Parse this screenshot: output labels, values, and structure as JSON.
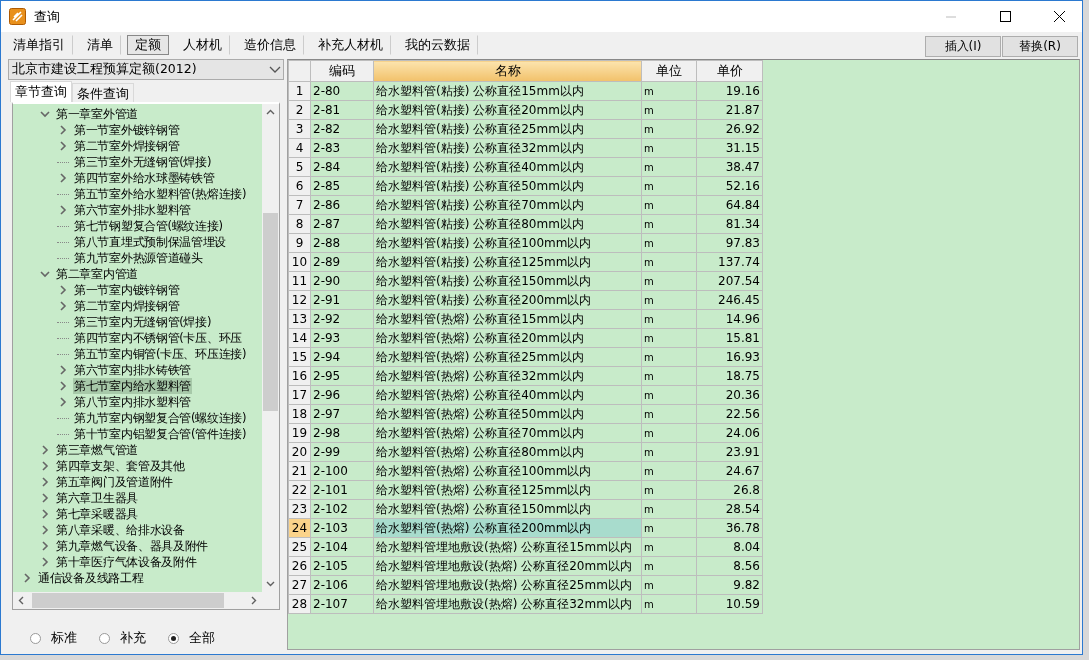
{
  "window": {
    "title": "查询"
  },
  "tabs": [
    {
      "label": "清单指引",
      "selected": false
    },
    {
      "label": "清单",
      "selected": false
    },
    {
      "label": "定额",
      "selected": true
    },
    {
      "label": "人材机",
      "selected": false
    },
    {
      "label": "造价信息",
      "selected": false
    },
    {
      "label": "补充人材机",
      "selected": false
    },
    {
      "label": "我的云数据",
      "selected": false
    }
  ],
  "buttons": [
    "插入(I)",
    "替换(R)"
  ],
  "quota_dropdown": {
    "value": "北京市建设工程预算定额(2012)"
  },
  "sub_tabs": [
    {
      "label": "章节查询",
      "selected": true
    },
    {
      "label": "条件查询",
      "selected": false
    }
  ],
  "tree": {
    "items": [
      {
        "kind": "group",
        "children": [
          {
            "label": "第一章室外管道",
            "kind": "folder",
            "expanded": true,
            "selected": false,
            "children": [
              {
                "label": "第一节室外镀锌钢管",
                "kind": "folder",
                "expanded": false,
                "selected": false
              },
              {
                "label": "第二节室外焊接钢管",
                "kind": "folder",
                "expanded": false,
                "selected": false
              },
              {
                "label": "第三节室外无缝钢管(焊接)",
                "kind": "leaf",
                "selected": false
              },
              {
                "label": "第四节室外给水球墨铸铁管",
                "kind": "folder",
                "expanded": false,
                "selected": false
              },
              {
                "label": "第五节室外给水塑料管(热熔连接)",
                "kind": "leaf",
                "selected": false
              },
              {
                "label": "第六节室外排水塑料管",
                "kind": "folder",
                "expanded": false,
                "selected": false
              },
              {
                "label": "第七节钢塑复合管(螺纹连接)",
                "kind": "leaf",
                "selected": false
              },
              {
                "label": "第八节直埋式预制保温管埋设",
                "kind": "leaf",
                "selected": false
              },
              {
                "label": "第九节室外热源管道碰头",
                "kind": "leaf",
                "selected": false
              }
            ]
          },
          {
            "label": "第二章室内管道",
            "kind": "folder",
            "expanded": true,
            "selected": false,
            "children": [
              {
                "label": "第一节室内镀锌钢管",
                "kind": "folder",
                "expanded": false,
                "selected": false
              },
              {
                "label": "第二节室内焊接钢管",
                "kind": "folder",
                "expanded": false,
                "selected": false
              },
              {
                "label": "第三节室内无缝钢管(焊接)",
                "kind": "leaf",
                "selected": false
              },
              {
                "label": "第四节室内不锈钢管(卡压、环压",
                "kind": "leaf",
                "selected": false
              },
              {
                "label": "第五节室内铜管(卡压、环压连接)",
                "kind": "leaf",
                "selected": false
              },
              {
                "label": "第六节室内排水铸铁管",
                "kind": "folder",
                "expanded": false,
                "selected": false
              },
              {
                "label": "第七节室内给水塑料管",
                "kind": "folder",
                "expanded": false,
                "selected": true
              },
              {
                "label": "第八节室内排水塑料管",
                "kind": "folder",
                "expanded": false,
                "selected": false
              },
              {
                "label": "第九节室内钢塑复合管(螺纹连接)",
                "kind": "leaf",
                "selected": false
              },
              {
                "label": "第十节室内铝塑复合管(管件连接)",
                "kind": "leaf",
                "selected": false
              }
            ]
          },
          {
            "label": "第三章燃气管道",
            "kind": "folder",
            "expanded": false,
            "selected": false
          },
          {
            "label": "第四章支架、套管及其他",
            "kind": "folder",
            "expanded": false,
            "selected": false
          },
          {
            "label": "第五章阀门及管道附件",
            "kind": "folder",
            "expanded": false,
            "selected": false
          },
          {
            "label": "第六章卫生器具",
            "kind": "folder",
            "expanded": false,
            "selected": false
          },
          {
            "label": "第七章采暖器具",
            "kind": "folder",
            "expanded": false,
            "selected": false
          },
          {
            "label": "第八章采暖、给排水设备",
            "kind": "folder",
            "expanded": false,
            "selected": false
          },
          {
            "label": "第九章燃气设备、器具及附件",
            "kind": "folder",
            "expanded": false,
            "selected": false
          },
          {
            "label": "第十章医疗气体设备及附件",
            "kind": "folder",
            "expanded": false,
            "selected": false
          }
        ]
      },
      {
        "label": "通信设备及线路工程",
        "kind": "folder",
        "expanded": false,
        "selected": false
      }
    ]
  },
  "filter_radios": [
    {
      "label": "标准",
      "selected": false
    },
    {
      "label": "补充",
      "selected": false
    },
    {
      "label": "全部",
      "selected": true
    }
  ],
  "table": {
    "columns": [
      {
        "label": "编码",
        "highlighted": false
      },
      {
        "label": "名称",
        "highlighted": true
      },
      {
        "label": "单位",
        "highlighted": false
      },
      {
        "label": "单价",
        "highlighted": false
      }
    ],
    "rows": [
      {
        "no": "1",
        "code": "2-80",
        "name": "给水塑料管(粘接) 公称直径15mm以内",
        "unit": "m",
        "price": "19.16",
        "selected": false
      },
      {
        "no": "2",
        "code": "2-81",
        "name": "给水塑料管(粘接) 公称直径20mm以内",
        "unit": "m",
        "price": "21.87",
        "selected": false
      },
      {
        "no": "3",
        "code": "2-82",
        "name": "给水塑料管(粘接) 公称直径25mm以内",
        "unit": "m",
        "price": "26.92",
        "selected": false
      },
      {
        "no": "4",
        "code": "2-83",
        "name": "给水塑料管(粘接) 公称直径32mm以内",
        "unit": "m",
        "price": "31.15",
        "selected": false
      },
      {
        "no": "5",
        "code": "2-84",
        "name": "给水塑料管(粘接) 公称直径40mm以内",
        "unit": "m",
        "price": "38.47",
        "selected": false
      },
      {
        "no": "6",
        "code": "2-85",
        "name": "给水塑料管(粘接) 公称直径50mm以内",
        "unit": "m",
        "price": "52.16",
        "selected": false
      },
      {
        "no": "7",
        "code": "2-86",
        "name": "给水塑料管(粘接) 公称直径70mm以内",
        "unit": "m",
        "price": "64.84",
        "selected": false
      },
      {
        "no": "8",
        "code": "2-87",
        "name": "给水塑料管(粘接) 公称直径80mm以内",
        "unit": "m",
        "price": "81.34",
        "selected": false
      },
      {
        "no": "9",
        "code": "2-88",
        "name": "给水塑料管(粘接) 公称直径100mm以内",
        "unit": "m",
        "price": "97.83",
        "selected": false
      },
      {
        "no": "10",
        "code": "2-89",
        "name": "给水塑料管(粘接) 公称直径125mm以内",
        "unit": "m",
        "price": "137.74",
        "selected": false
      },
      {
        "no": "11",
        "code": "2-90",
        "name": "给水塑料管(粘接) 公称直径150mm以内",
        "unit": "m",
        "price": "207.54",
        "selected": false
      },
      {
        "no": "12",
        "code": "2-91",
        "name": "给水塑料管(粘接) 公称直径200mm以内",
        "unit": "m",
        "price": "246.45",
        "selected": false
      },
      {
        "no": "13",
        "code": "2-92",
        "name": "给水塑料管(热熔) 公称直径15mm以内",
        "unit": "m",
        "price": "14.96",
        "selected": false
      },
      {
        "no": "14",
        "code": "2-93",
        "name": "给水塑料管(热熔) 公称直径20mm以内",
        "unit": "m",
        "price": "15.81",
        "selected": false
      },
      {
        "no": "15",
        "code": "2-94",
        "name": "给水塑料管(热熔) 公称直径25mm以内",
        "unit": "m",
        "price": "16.93",
        "selected": false
      },
      {
        "no": "16",
        "code": "2-95",
        "name": "给水塑料管(热熔) 公称直径32mm以内",
        "unit": "m",
        "price": "18.75",
        "selected": false
      },
      {
        "no": "17",
        "code": "2-96",
        "name": "给水塑料管(热熔) 公称直径40mm以内",
        "unit": "m",
        "price": "20.36",
        "selected": false
      },
      {
        "no": "18",
        "code": "2-97",
        "name": "给水塑料管(热熔) 公称直径50mm以内",
        "unit": "m",
        "price": "22.56",
        "selected": false
      },
      {
        "no": "19",
        "code": "2-98",
        "name": "给水塑料管(热熔) 公称直径70mm以内",
        "unit": "m",
        "price": "24.06",
        "selected": false
      },
      {
        "no": "20",
        "code": "2-99",
        "name": "给水塑料管(热熔) 公称直径80mm以内",
        "unit": "m",
        "price": "23.91",
        "selected": false
      },
      {
        "no": "21",
        "code": "2-100",
        "name": "给水塑料管(热熔) 公称直径100mm以内",
        "unit": "m",
        "price": "24.67",
        "selected": false
      },
      {
        "no": "22",
        "code": "2-101",
        "name": "给水塑料管(热熔) 公称直径125mm以内",
        "unit": "m",
        "price": "26.8",
        "selected": false
      },
      {
        "no": "23",
        "code": "2-102",
        "name": "给水塑料管(热熔) 公称直径150mm以内",
        "unit": "m",
        "price": "28.54",
        "selected": false
      },
      {
        "no": "24",
        "code": "2-103",
        "name": "给水塑料管(热熔) 公称直径200mm以内",
        "unit": "m",
        "price": "36.78",
        "selected": true
      },
      {
        "no": "25",
        "code": "2-104",
        "name": "给水塑料管埋地敷设(热熔) 公称直径15mm以内",
        "unit": "m",
        "price": "8.04",
        "selected": false
      },
      {
        "no": "26",
        "code": "2-105",
        "name": "给水塑料管埋地敷设(热熔) 公称直径20mm以内",
        "unit": "m",
        "price": "8.56",
        "selected": false
      },
      {
        "no": "27",
        "code": "2-106",
        "name": "给水塑料管埋地敷设(热熔) 公称直径25mm以内",
        "unit": "m",
        "price": "9.82",
        "selected": false
      },
      {
        "no": "28",
        "code": "2-107",
        "name": "给水塑料管埋地敷设(热熔) 公称直径32mm以内",
        "unit": "m",
        "price": "10.59",
        "selected": false
      }
    ]
  }
}
